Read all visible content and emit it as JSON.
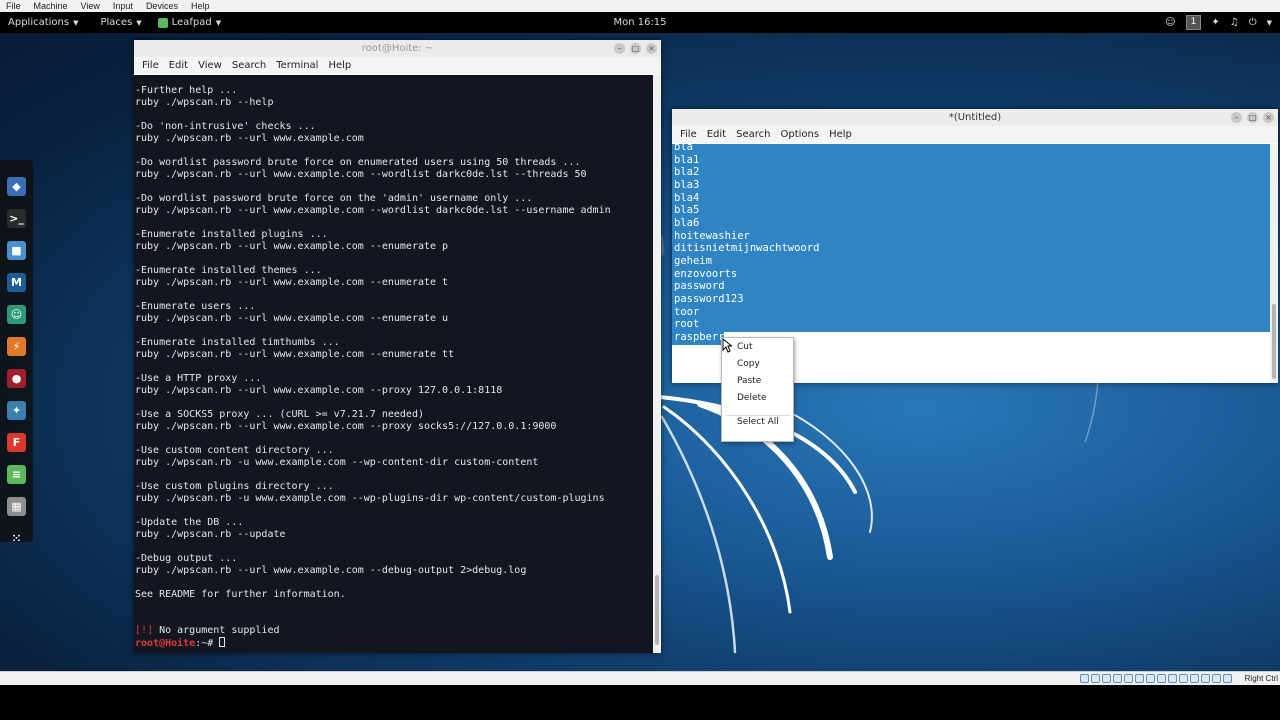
{
  "vbox_menu": [
    "File",
    "Machine",
    "View",
    "Input",
    "Devices",
    "Help"
  ],
  "topbar": {
    "applications": "Applications",
    "places": "Places",
    "active_app": "Leafpad",
    "clock": "Mon 16:15",
    "workspace": "1"
  },
  "dock": [
    {
      "name": "Kali icon",
      "color": "#3a6fb6",
      "glyph": "◆"
    },
    {
      "name": "Terminal",
      "color": "#2b2b2b",
      "glyph": ">_"
    },
    {
      "name": "Files",
      "color": "#4a8fcf",
      "glyph": "■"
    },
    {
      "name": "Metasploit",
      "color": "#1f5d96",
      "glyph": "M"
    },
    {
      "name": "Armitage",
      "color": "#2e9a7a",
      "glyph": "☺"
    },
    {
      "name": "Burp Suite",
      "color": "#e07a2a",
      "glyph": "⚡"
    },
    {
      "name": "Maltego",
      "color": "#a01f2a",
      "glyph": "●"
    },
    {
      "name": "BeEF",
      "color": "#3a7fb0",
      "glyph": "✦"
    },
    {
      "name": "Faraday",
      "color": "#d9382b",
      "glyph": "F"
    },
    {
      "name": "Leafpad",
      "color": "#5cb85c",
      "glyph": "≡"
    },
    {
      "name": "Keyboard",
      "color": "#8e8e8e",
      "glyph": "▦"
    },
    {
      "name": "Show Applications",
      "color": "transparent",
      "glyph": "⁙"
    }
  ],
  "terminal": {
    "title": "root@Hoite: ~",
    "menu": [
      "File",
      "Edit",
      "View",
      "Search",
      "Terminal",
      "Help"
    ],
    "lines": [
      "-Further help ...",
      "ruby ./wpscan.rb --help",
      "",
      "-Do 'non-intrusive' checks ...",
      "ruby ./wpscan.rb --url www.example.com",
      "",
      "-Do wordlist password brute force on enumerated users using 50 threads ...",
      "ruby ./wpscan.rb --url www.example.com --wordlist darkc0de.lst --threads 50",
      "",
      "-Do wordlist password brute force on the 'admin' username only ...",
      "ruby ./wpscan.rb --url www.example.com --wordlist darkc0de.lst --username admin",
      "",
      "-Enumerate installed plugins ...",
      "ruby ./wpscan.rb --url www.example.com --enumerate p",
      "",
      "-Enumerate installed themes ...",
      "ruby ./wpscan.rb --url www.example.com --enumerate t",
      "",
      "-Enumerate users ...",
      "ruby ./wpscan.rb --url www.example.com --enumerate u",
      "",
      "-Enumerate installed timthumbs ...",
      "ruby ./wpscan.rb --url www.example.com --enumerate tt",
      "",
      "-Use a HTTP proxy ...",
      "ruby ./wpscan.rb --url www.example.com --proxy 127.0.0.1:8118",
      "",
      "-Use a SOCKS5 proxy ... (cURL >= v7.21.7 needed)",
      "ruby ./wpscan.rb --url www.example.com --proxy socks5://127.0.0.1:9000",
      "",
      "-Use custom content directory ...",
      "ruby ./wpscan.rb -u www.example.com --wp-content-dir custom-content",
      "",
      "-Use custom plugins directory ...",
      "ruby ./wpscan.rb -u www.example.com --wp-plugins-dir wp-content/custom-plugins",
      "",
      "-Update the DB ...",
      "ruby ./wpscan.rb --update",
      "",
      "-Debug output ...",
      "ruby ./wpscan.rb --url www.example.com --debug-output 2>debug.log",
      "",
      "See README for further information.",
      "",
      ""
    ],
    "error_tag": "[!]",
    "error_msg": " No argument supplied",
    "prompt_user": "root@Hoite",
    "prompt_rest": ":~# "
  },
  "leafpad": {
    "title": "*(Untitled)",
    "menu": [
      "File",
      "Edit",
      "Search",
      "Options",
      "Help"
    ],
    "lines": [
      "bla",
      "bla1",
      "bla2",
      "bla3",
      "bla4",
      "bla5",
      "bla6",
      "hoitewashier",
      "ditisnietmijnwachtwoord",
      "geheim",
      "enzovoorts",
      "password",
      "password123",
      "toor",
      "root",
      "raspberry"
    ]
  },
  "context_menu": {
    "cut": "Cut",
    "copy": "Copy",
    "paste": "Paste",
    "delete": "Delete",
    "select_all": "Select All"
  },
  "vbox_status": {
    "host_key": "Right Ctrl"
  }
}
